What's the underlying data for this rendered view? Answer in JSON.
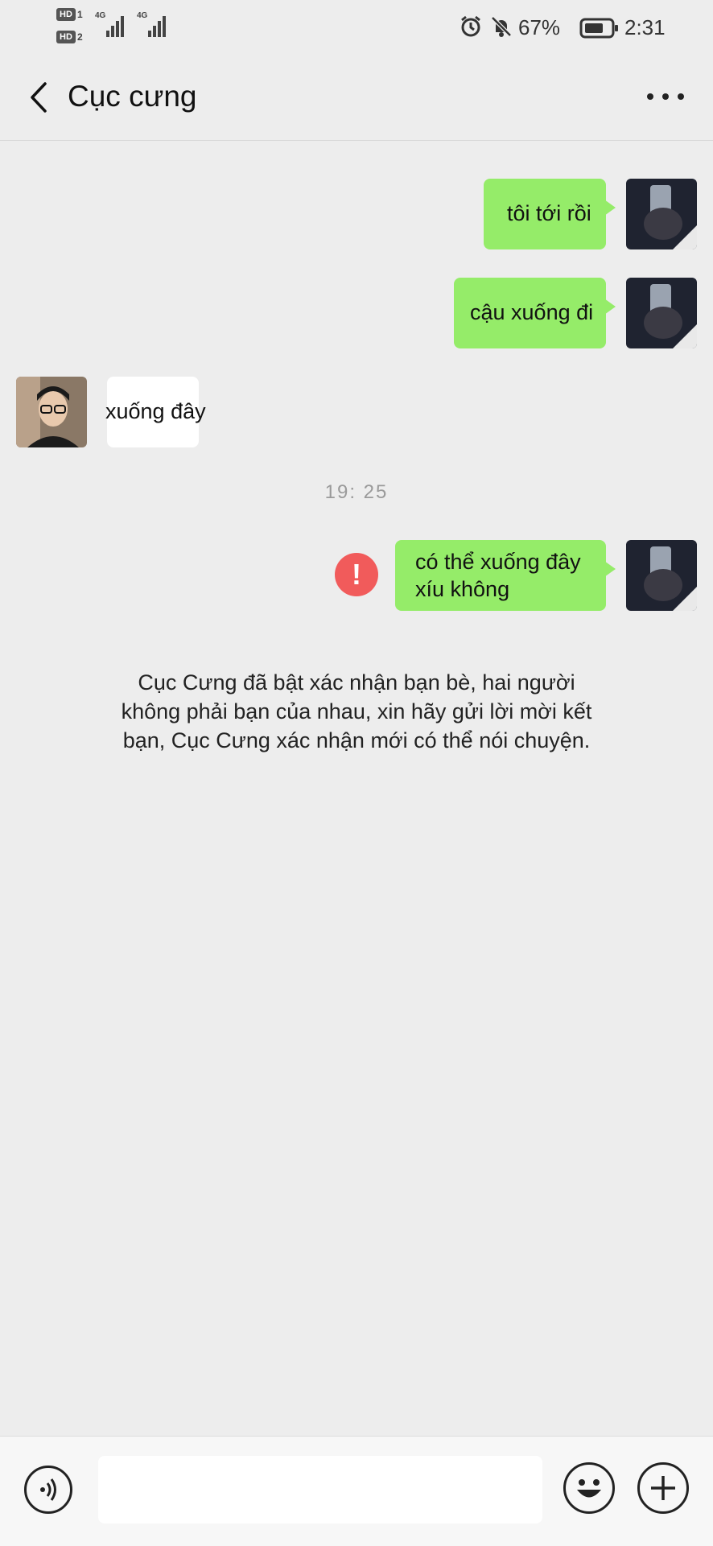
{
  "status_bar": {
    "sim1_label": "HD",
    "sim1_num": "1",
    "sim2_label": "HD",
    "sim2_num": "2",
    "network1": "4G",
    "network2": "4G",
    "battery_percent": "67%",
    "time": "2:31"
  },
  "header": {
    "title": "Cục cưng"
  },
  "messages": [
    {
      "direction": "out",
      "text": "tôi tới rồi"
    },
    {
      "direction": "out",
      "text": "cậu xuống đi"
    },
    {
      "direction": "in",
      "text": "xuống đây"
    },
    {
      "direction": "out",
      "text_line1": "có thể xuống đây",
      "text_line2": "xíu không",
      "status": "failed"
    }
  ],
  "timestamp": "19:  25",
  "system_notice": {
    "line1": "Cục Cưng đã bật xác nhận bạn bè, hai người",
    "line2": "không phải bạn của nhau, xin hãy gửi lời mời kết",
    "line3": "bạn, Cục Cưng xác nhận mới có thể nói chuyện."
  },
  "input_bar": {
    "placeholder": ""
  },
  "colors": {
    "outgoing_bubble": "#95ec69",
    "incoming_bubble": "#ffffff",
    "error": "#f15b5b",
    "background": "#ededed"
  }
}
